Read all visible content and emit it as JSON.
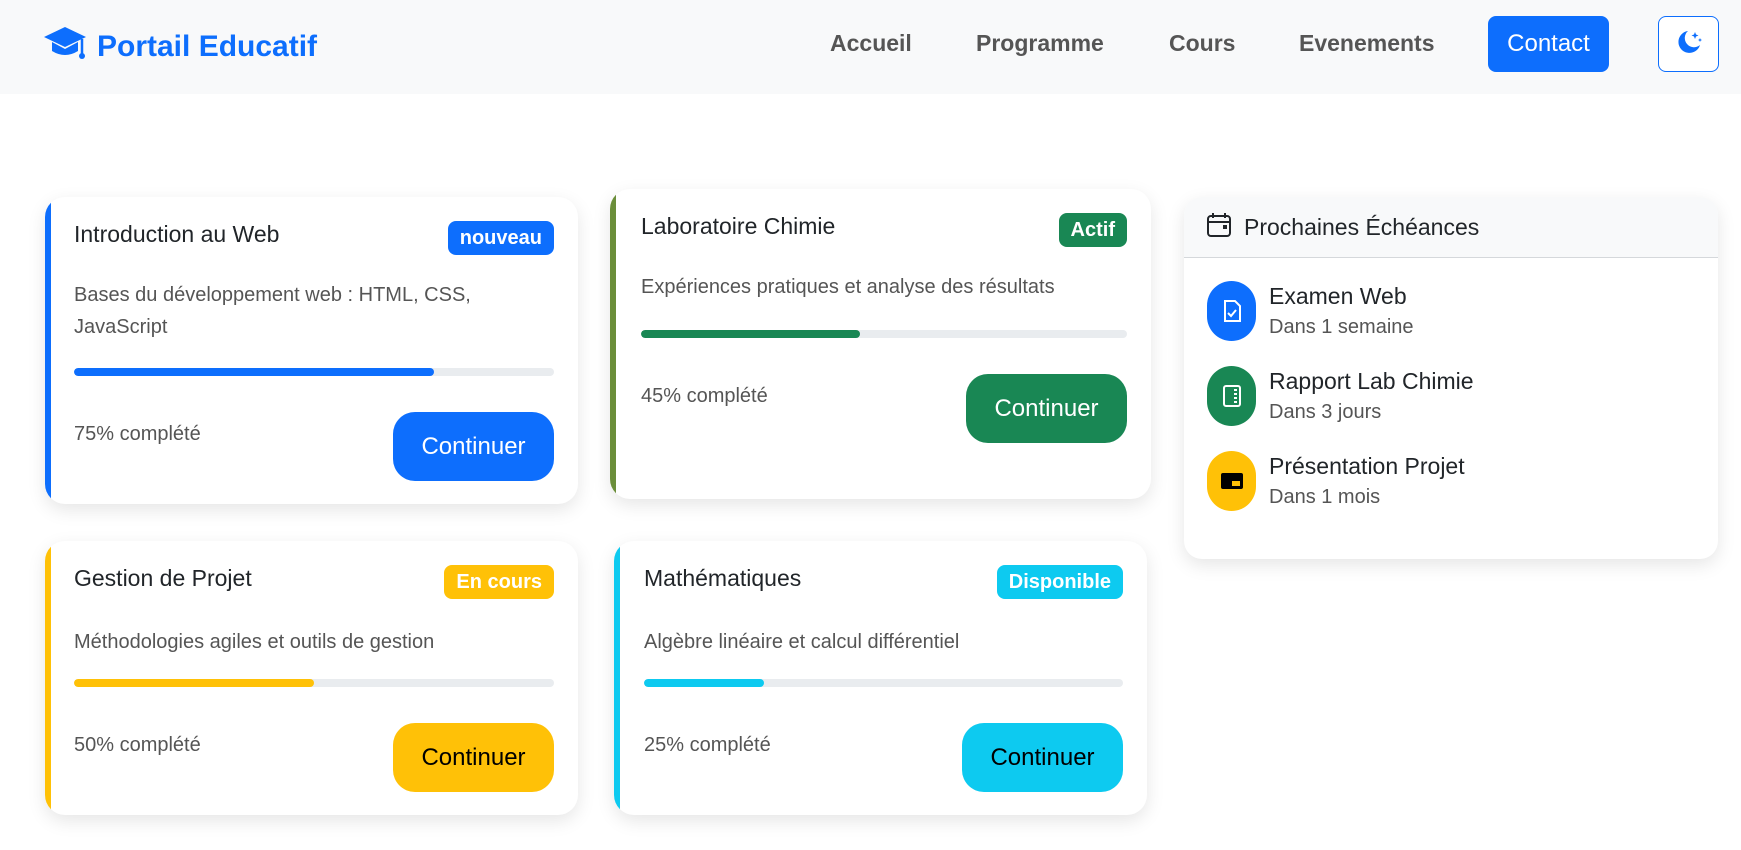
{
  "navbar": {
    "brand": "Portail Educatif",
    "links": [
      "Accueil",
      "Programme",
      "Cours",
      "Evenements"
    ],
    "contact": "Contact"
  },
  "colors": {
    "primary": "#0d6efd",
    "success": "#198754",
    "warning": "#ffc107",
    "info": "#0dcaf0",
    "olive": "#6b8e3a"
  },
  "courses": [
    {
      "title": "Introduction au Web",
      "badge": "nouveau",
      "description_line1": "Bases du développement web : HTML, CSS,",
      "description_line2": "JavaScript",
      "progress": 0.75,
      "progress_text": "75% complété",
      "button": "Continuer"
    },
    {
      "title": "Laboratoire Chimie",
      "badge": "Actif",
      "description": "Expériences pratiques et analyse des résultats",
      "progress": 0.45,
      "progress_text": "45% complété",
      "button": "Continuer"
    },
    {
      "title": "Gestion de Projet",
      "badge": "En cours",
      "description": "Méthodologies agiles et outils de gestion",
      "progress": 0.5,
      "progress_text": "50% complété",
      "button": "Continuer"
    },
    {
      "title": "Mathématiques",
      "badge": "Disponible",
      "description": "Algèbre linéaire et calcul différentiel",
      "progress": 0.25,
      "progress_text": "25% complété",
      "button": "Continuer"
    }
  ],
  "deadlines": {
    "title": "Prochaines Échéances",
    "items": [
      {
        "name": "Examen Web",
        "when": "Dans 1 semaine",
        "icon": "file-check-icon"
      },
      {
        "name": "Rapport Lab Chimie",
        "when": "Dans 3 jours",
        "icon": "journal-icon"
      },
      {
        "name": "Présentation Projet",
        "when": "Dans 1 mois",
        "icon": "presentation-icon"
      }
    ]
  }
}
